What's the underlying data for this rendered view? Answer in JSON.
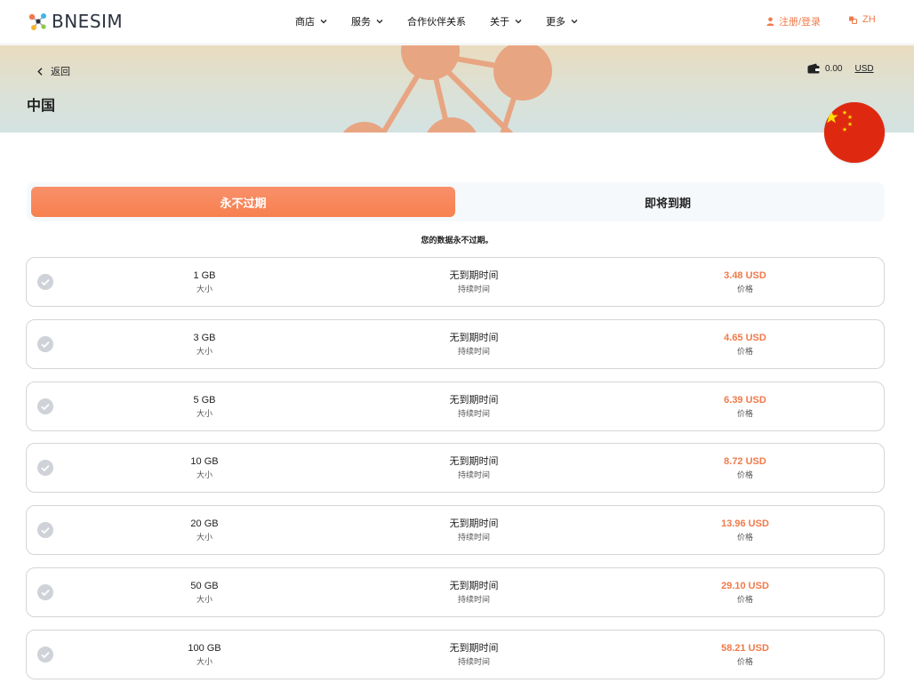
{
  "header": {
    "logo_text": "BNESIM",
    "nav": [
      {
        "label": "商店",
        "dropdown": true
      },
      {
        "label": "服务",
        "dropdown": true
      },
      {
        "label": "合作伙伴关系",
        "dropdown": false
      },
      {
        "label": "关于",
        "dropdown": true
      },
      {
        "label": "更多",
        "dropdown": true
      }
    ],
    "login_label": "注册/登录",
    "language_label": "ZH"
  },
  "banner": {
    "back_label": "返回",
    "country_title": "中国",
    "wallet_amount": "0.00",
    "wallet_currency": "USD"
  },
  "tabs": {
    "active_label": "永不过期",
    "inactive_label": "即将到期"
  },
  "notice": "您的数据永不过期。",
  "plans": [
    {
      "size": "1 GB",
      "size_label": "大小",
      "duration": "无到期时间",
      "duration_label": "持续时间",
      "price": "3.48 USD",
      "price_label": "价格"
    },
    {
      "size": "3 GB",
      "size_label": "大小",
      "duration": "无到期时间",
      "duration_label": "持续时间",
      "price": "4.65 USD",
      "price_label": "价格"
    },
    {
      "size": "5 GB",
      "size_label": "大小",
      "duration": "无到期时间",
      "duration_label": "持续时间",
      "price": "6.39 USD",
      "price_label": "价格"
    },
    {
      "size": "10 GB",
      "size_label": "大小",
      "duration": "无到期时间",
      "duration_label": "持续时间",
      "price": "8.72 USD",
      "price_label": "价格"
    },
    {
      "size": "20 GB",
      "size_label": "大小",
      "duration": "无到期时间",
      "duration_label": "持续时间",
      "price": "13.96 USD",
      "price_label": "价格"
    },
    {
      "size": "50 GB",
      "size_label": "大小",
      "duration": "无到期时间",
      "duration_label": "持续时间",
      "price": "29.10 USD",
      "price_label": "价格"
    },
    {
      "size": "100 GB",
      "size_label": "大小",
      "duration": "无到期时间",
      "duration_label": "持续时间",
      "price": "58.21 USD",
      "price_label": "价格"
    }
  ],
  "colors": {
    "accent": "#f07a4b",
    "tab_active": "#f7804f",
    "border": "#d5d5d5",
    "check_gray": "#cfd2d8",
    "flag_red": "#de2910",
    "flag_star": "#ffde00"
  }
}
